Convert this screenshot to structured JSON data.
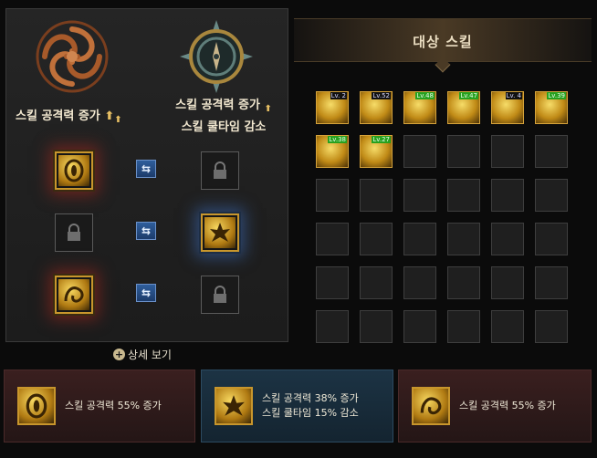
{
  "left_panel": {
    "label_left": "스킬 공격력 증가",
    "label_right_line1": "스킬 공격력 증가",
    "label_right_line2": "스킬 쿨타임 감소",
    "arrow": "⬆",
    "swap_symbol": "⇆",
    "detail_link": "상세 보기",
    "detail_icon": "+",
    "emblem_left_icon": "swirl-emblem-icon",
    "emblem_right_icon": "compass-emblem-icon"
  },
  "target_panel": {
    "title": "대상 스킬",
    "skills": [
      {
        "level": "Lv. 2"
      },
      {
        "level": "Lv.52"
      },
      {
        "level": "Lv.48"
      },
      {
        "level": "Lv.47"
      },
      {
        "level": "Lv. 4"
      },
      {
        "level": "Lv.39"
      },
      {
        "level": "Lv.38"
      },
      {
        "level": "Lv.27"
      }
    ]
  },
  "summary": {
    "card1": "스킬 공격력 55% 증가",
    "card2_line1": "스킬 공격력 38% 증가",
    "card2_line2": "스킬 쿨타임 15% 감소",
    "card3": "스킬 공격력 55% 증가"
  },
  "colors": {
    "gold": "#c8962c",
    "red_glow": "#aa281e",
    "blue_glow": "#3c6ebe",
    "level_green": "#27a11f",
    "swap_blue": "#2f5e9c"
  }
}
